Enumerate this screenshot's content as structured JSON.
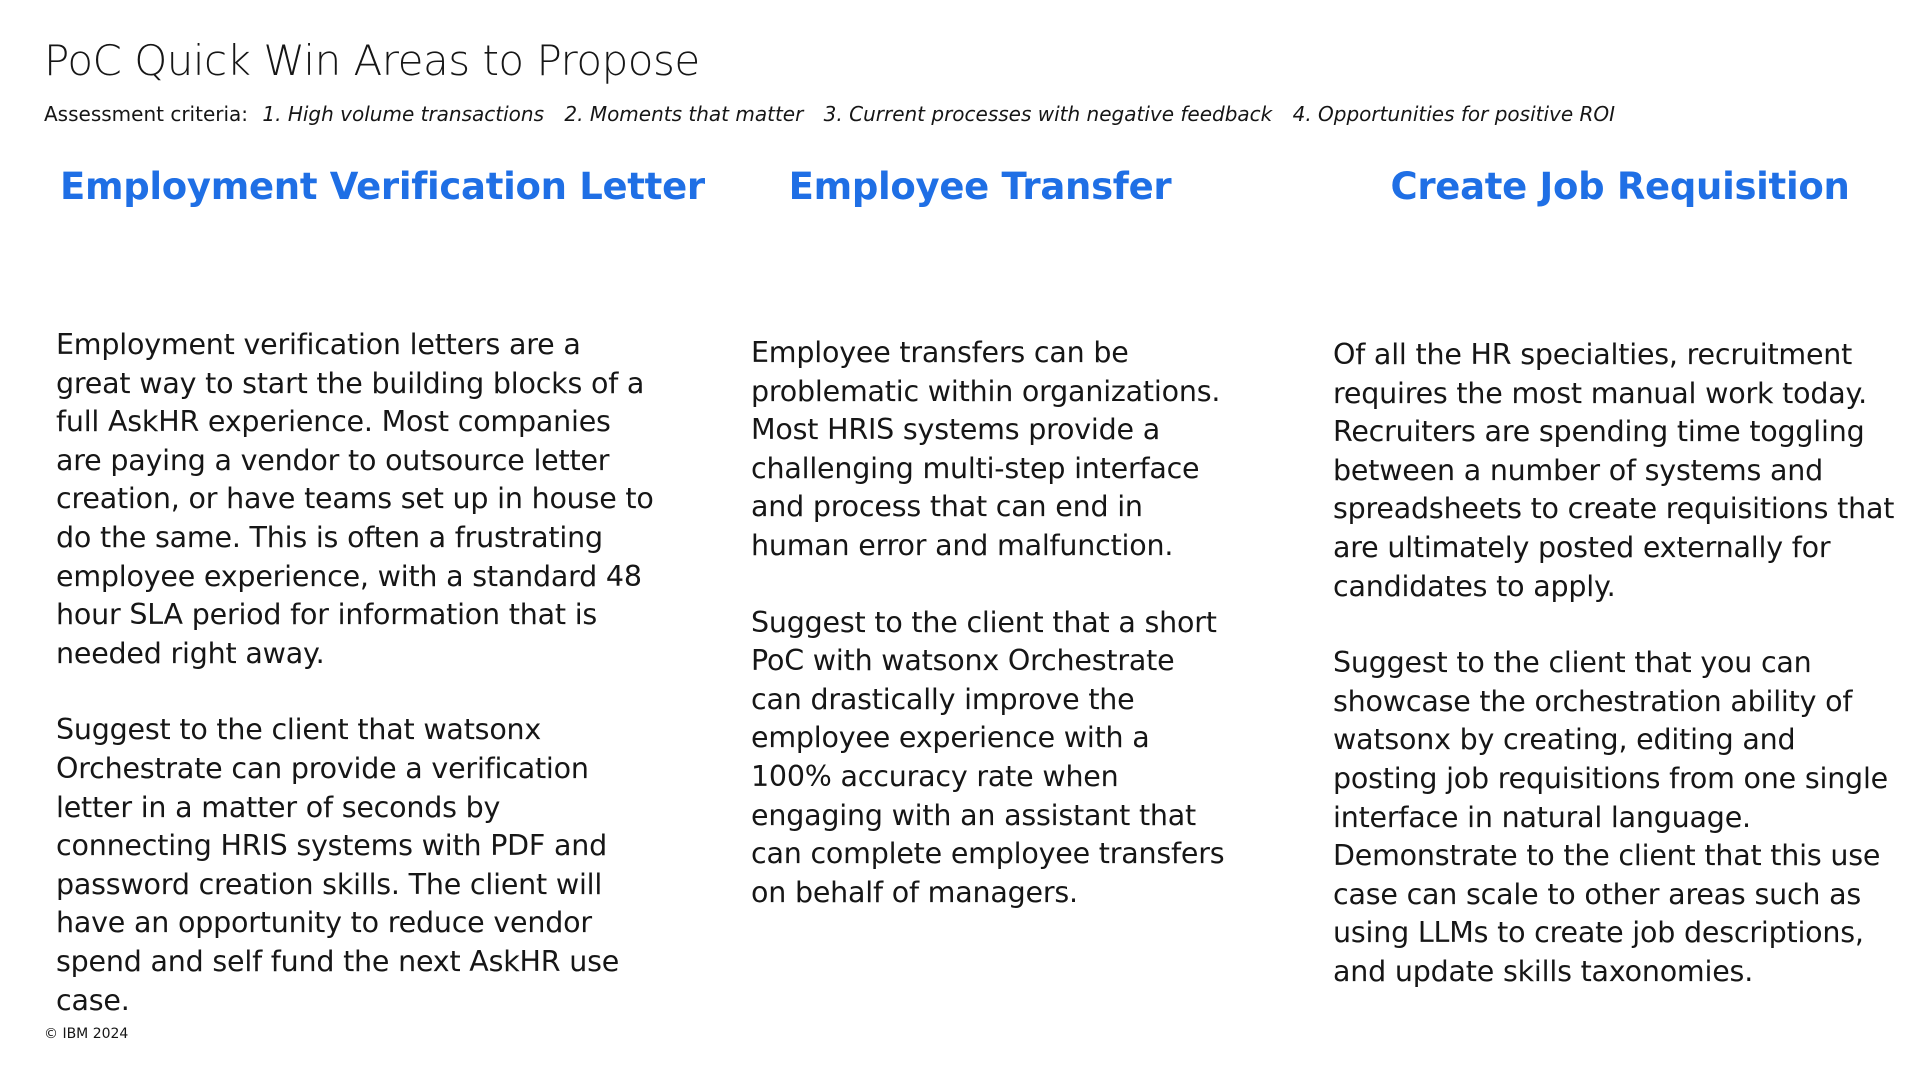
{
  "slide": {
    "title": "PoC Quick Win Areas to Propose",
    "criteria_label": "Assessment criteria:",
    "criteria": [
      "1. High volume transactions",
      "2. Moments that matter",
      "3. Current processes with negative feedback",
      "4. Opportunities for positive ROI"
    ],
    "columns": [
      {
        "heading": "Employment Verification Letter",
        "paragraphs": [
          "Employment verification letters are a great way to start the building blocks of a full AskHR experience. Most companies are paying a vendor to outsource letter creation, or have teams set up in house to do the same. This is often a frustrating employee experience, with a standard 48 hour SLA period for information that is needed right away.",
          "Suggest to the client that watsonx Orchestrate can provide a verification letter in a matter of seconds by connecting HRIS systems with PDF and password creation skills. The client will have an opportunity to reduce vendor spend and self fund the next AskHR use case."
        ]
      },
      {
        "heading": "Employee Transfer",
        "paragraphs": [
          "Employee transfers can be problematic within organizations. Most HRIS systems provide a challenging multi-step interface and process that can end in human error and malfunction.",
          "Suggest to the client that a short PoC with watsonx Orchestrate can drastically improve the employee experience with a 100% accuracy rate when engaging with an assistant that can complete employee transfers on behalf of managers."
        ]
      },
      {
        "heading": "Create Job Requisition",
        "paragraphs": [
          "Of all the HR specialties, recruitment requires the most manual work today. Recruiters are spending time toggling between a number of systems and spreadsheets to create requisitions that are ultimately posted externally for candidates to apply.",
          "Suggest to the client that you can showcase the orchestration ability of watsonx by creating, editing and posting job requisitions from one single interface in natural language. Demonstrate to the client that this use case can scale to other areas such as using LLMs to create job descriptions, and update skills taxonomies."
        ]
      }
    ],
    "footer": "© IBM 2024"
  }
}
